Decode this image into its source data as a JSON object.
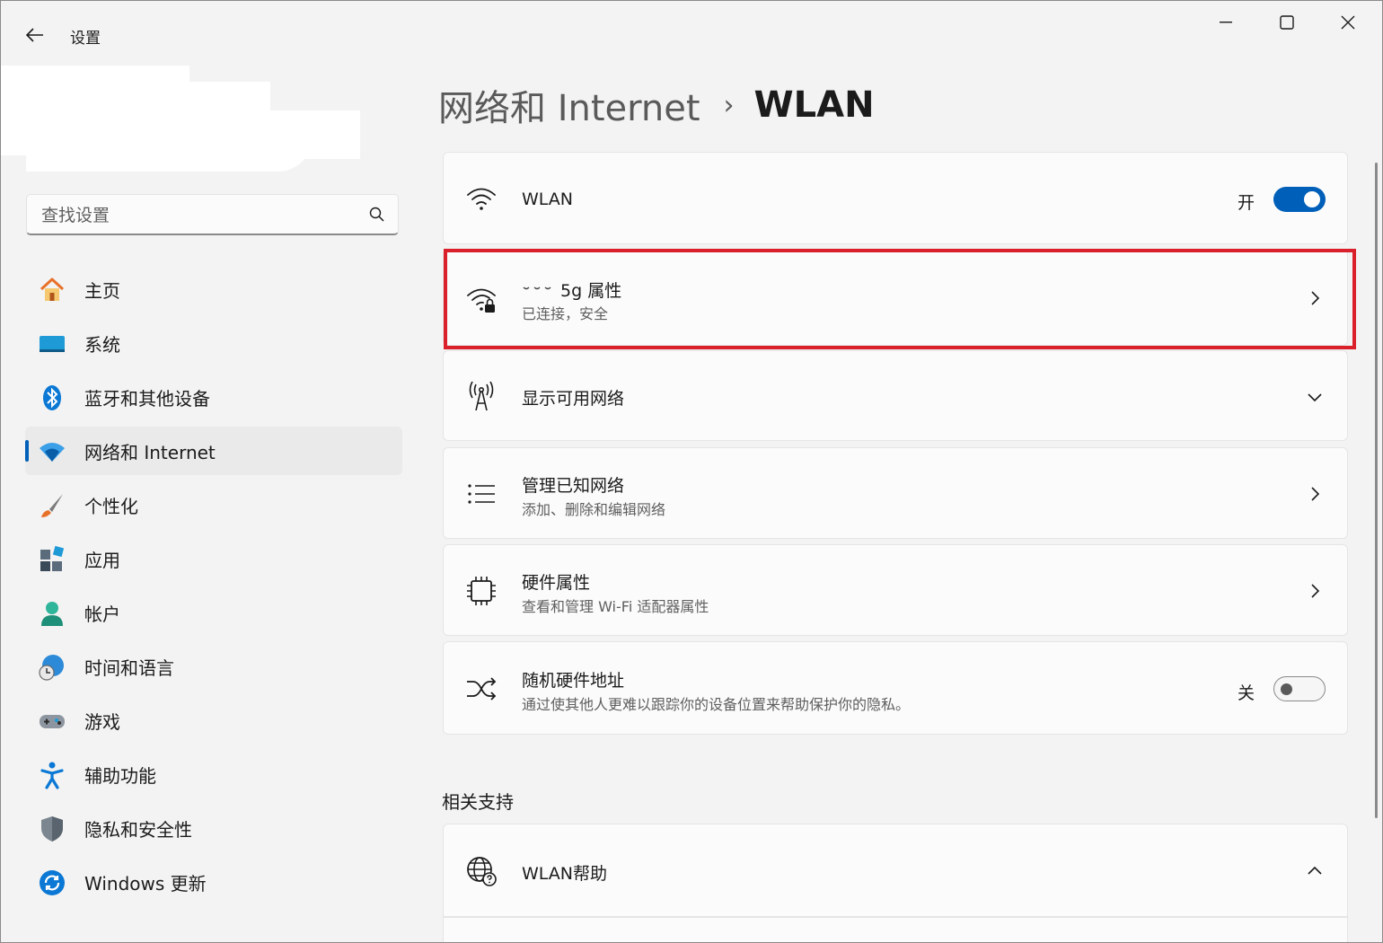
{
  "window": {
    "title": "设置",
    "back_icon": "arrow-left-icon",
    "controls": [
      "minimize-icon",
      "maximize-icon",
      "close-icon"
    ]
  },
  "search": {
    "placeholder": "查找设置",
    "icon": "search-icon"
  },
  "sidebar": {
    "items": [
      {
        "label": "主页",
        "icon": "home-icon",
        "active": false
      },
      {
        "label": "系统",
        "icon": "display-icon",
        "active": false
      },
      {
        "label": "蓝牙和其他设备",
        "icon": "bluetooth-icon",
        "active": false
      },
      {
        "label": "网络和 Internet",
        "icon": "wifi-icon",
        "active": true
      },
      {
        "label": "个性化",
        "icon": "brush-icon",
        "active": false
      },
      {
        "label": "应用",
        "icon": "apps-icon",
        "active": false
      },
      {
        "label": "帐户",
        "icon": "person-icon",
        "active": false
      },
      {
        "label": "时间和语言",
        "icon": "globe-clock-icon",
        "active": false
      },
      {
        "label": "游戏",
        "icon": "gamepad-icon",
        "active": false
      },
      {
        "label": "辅助功能",
        "icon": "accessibility-icon",
        "active": false
      },
      {
        "label": "隐私和安全性",
        "icon": "shield-icon",
        "active": false
      },
      {
        "label": "Windows 更新",
        "icon": "refresh-icon",
        "active": false
      }
    ]
  },
  "header": {
    "parent": "网络和 Internet",
    "separator": "›",
    "current": "WLAN"
  },
  "cards": {
    "wlan": {
      "title": "WLAN",
      "state": "开",
      "toggle_on": true,
      "icon": "wifi-icon"
    },
    "connected": {
      "title": "5g 属性",
      "subtitle": "已连接，安全",
      "icon": "wifi-lock-icon"
    },
    "available": {
      "title": "显示可用网络",
      "icon": "antenna-icon"
    },
    "manage": {
      "title": "管理已知网络",
      "subtitle": "添加、删除和编辑网络",
      "icon": "list-icon"
    },
    "hardware": {
      "title": "硬件属性",
      "subtitle": "查看和管理 Wi-Fi 适配器属性",
      "icon": "chip-icon"
    },
    "random_mac": {
      "title": "随机硬件地址",
      "subtitle": "通过使其他人更难以跟踪你的设备位置来帮助保护你的隐私。",
      "state": "关",
      "toggle_on": false,
      "icon": "shuffle-icon"
    }
  },
  "related": {
    "section_title": "相关支持",
    "help": {
      "title": "WLAN帮助",
      "icon": "globe-help-icon"
    }
  },
  "colors": {
    "accent": "#005fb8",
    "highlight": "#d9202b",
    "background": "#f3f3f3",
    "card": "#fbfbfb"
  }
}
